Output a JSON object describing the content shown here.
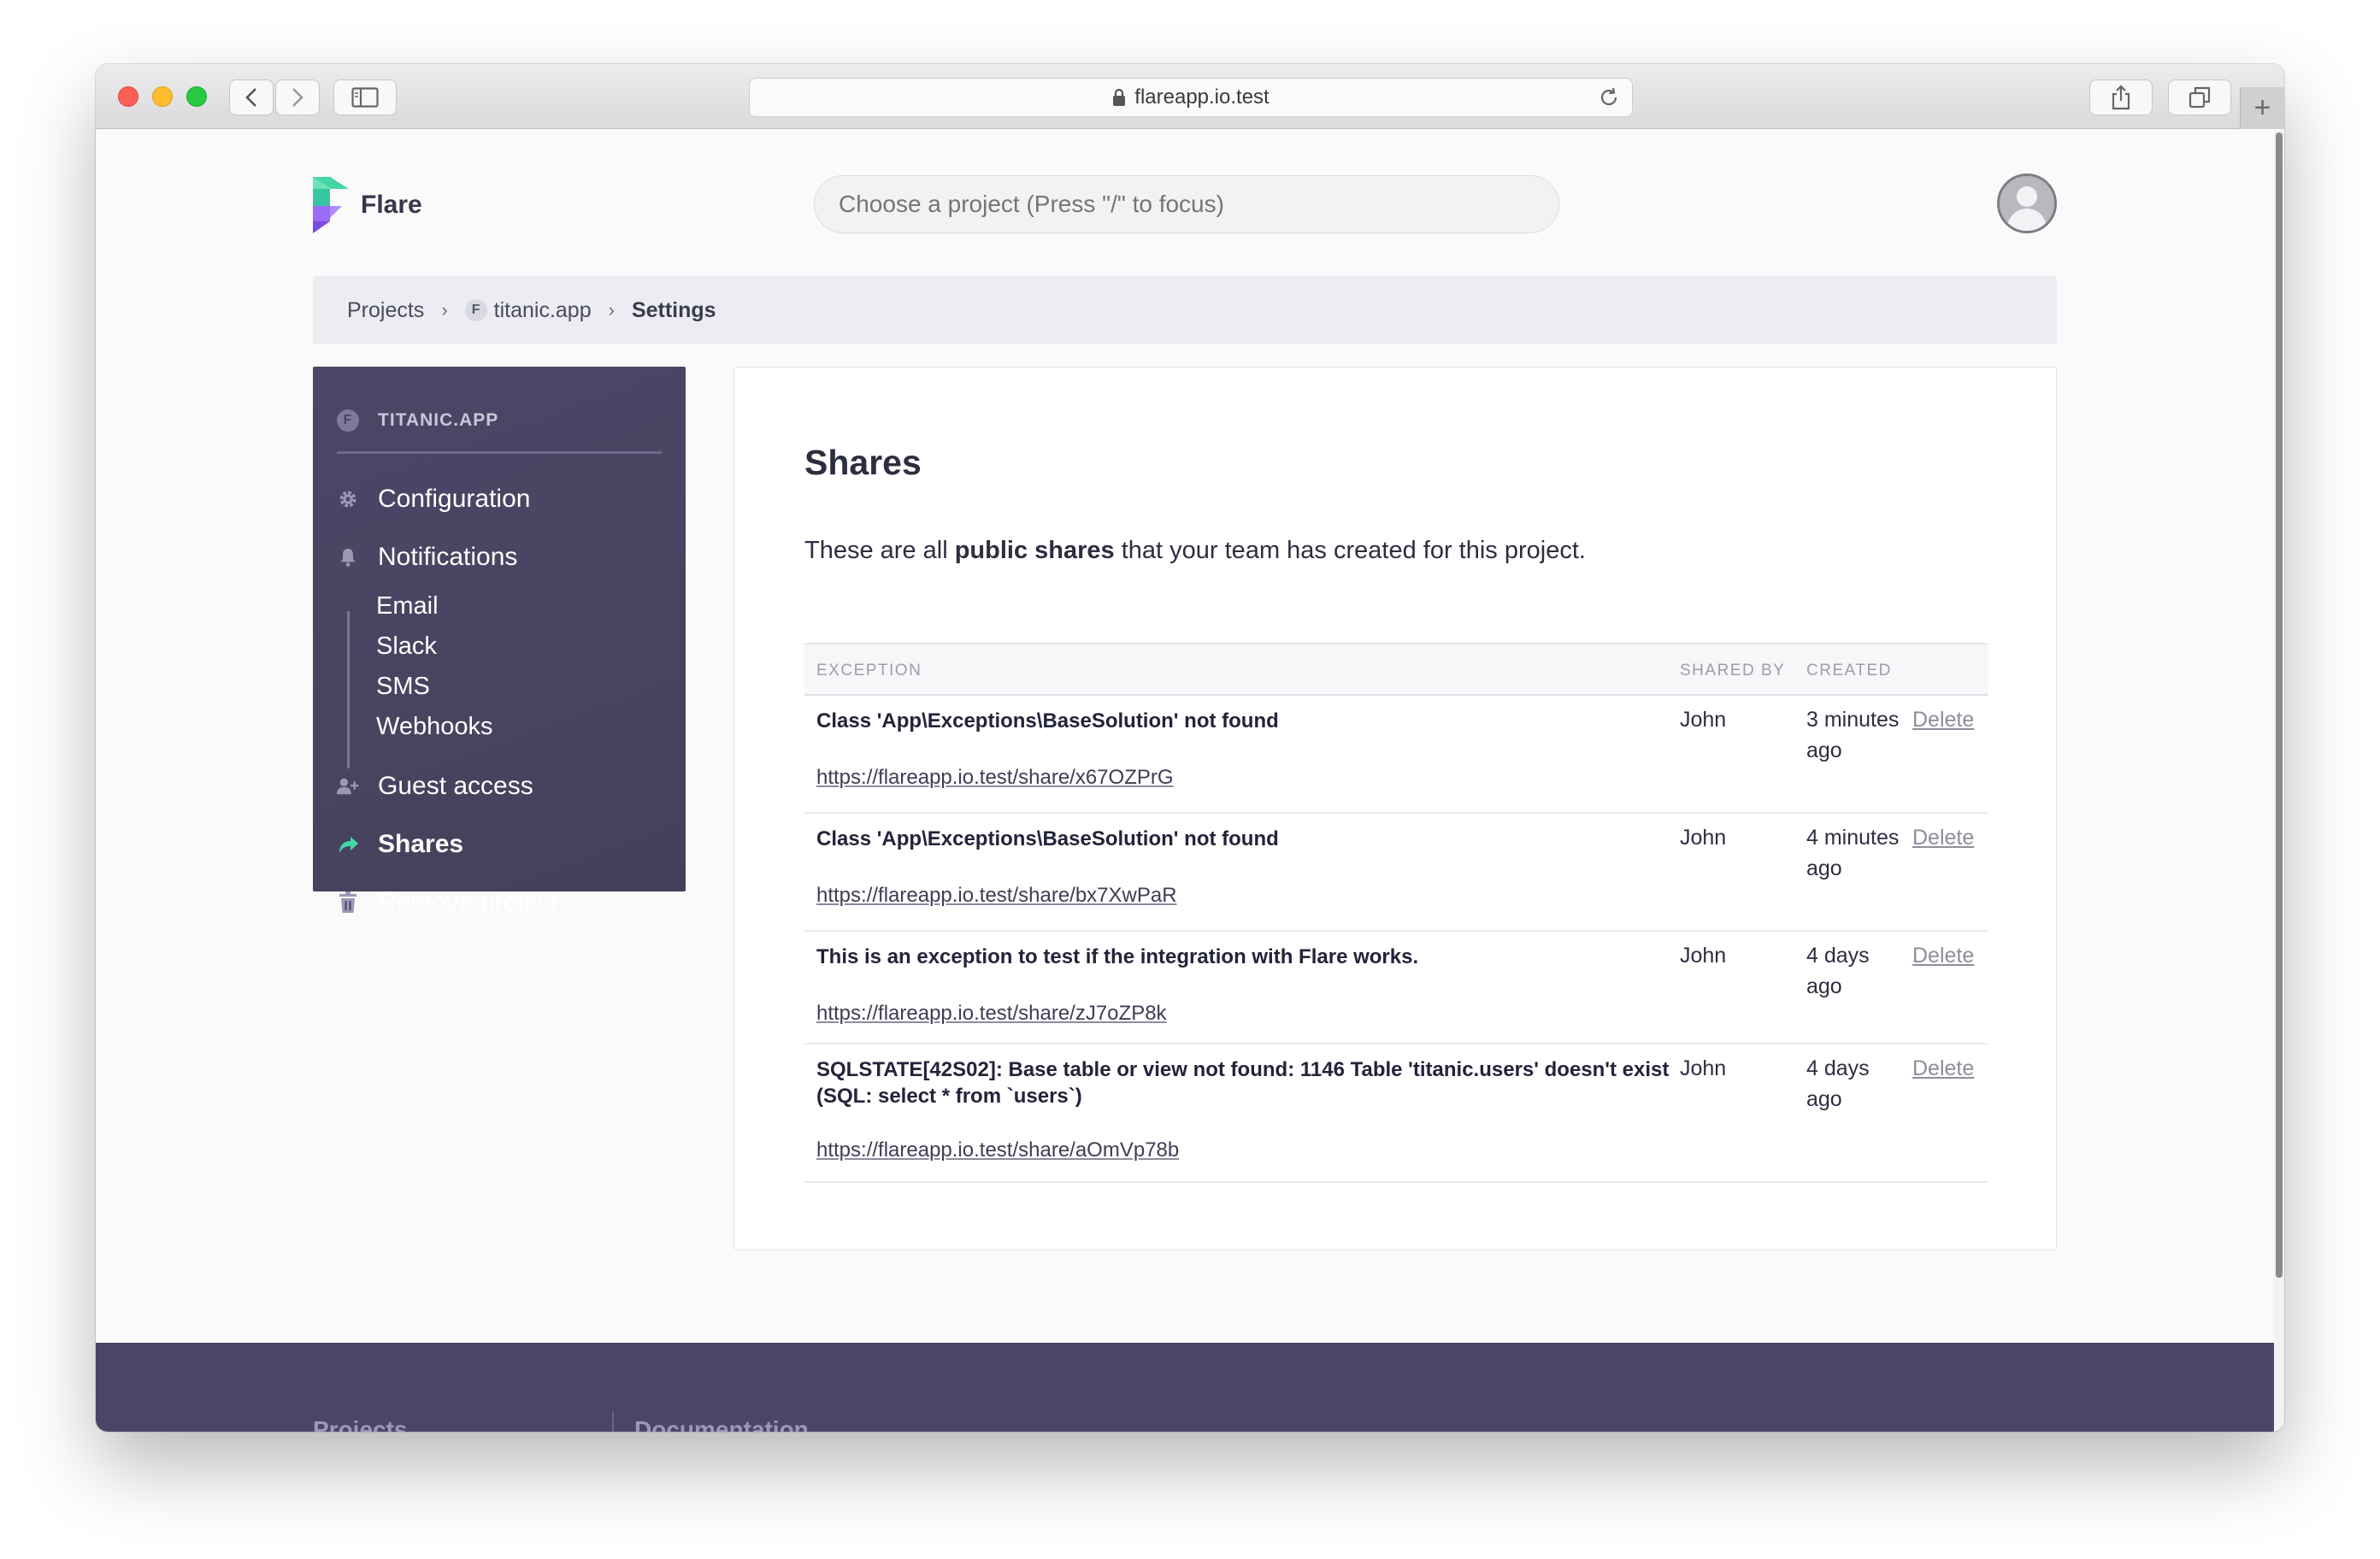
{
  "browser": {
    "url": "flareapp.io.test"
  },
  "app": {
    "name": "Flare",
    "search_placeholder": "Choose a project (Press \"/\" to focus)"
  },
  "breadcrumb": {
    "projects": "Projects",
    "project_badge": "F",
    "project": "titanic.app",
    "current": "Settings"
  },
  "sidebar": {
    "project_badge": "F",
    "project_name": "TITANIC.APP",
    "items": [
      {
        "label": "Configuration",
        "icon": "gear-icon"
      },
      {
        "label": "Notifications",
        "icon": "bell-icon"
      },
      {
        "label": "Guest access",
        "icon": "user-plus-icon"
      },
      {
        "label": "Shares",
        "icon": "share-arrow-icon",
        "active": true
      },
      {
        "label": "Remove project",
        "icon": "trash-icon"
      }
    ],
    "notification_subitems": [
      "Email",
      "Slack",
      "SMS",
      "Webhooks"
    ]
  },
  "main": {
    "title": "Shares",
    "intro_before": "These are all ",
    "intro_bold": "public shares",
    "intro_after": " that your team has created for this project.",
    "columns": [
      "EXCEPTION",
      "SHARED BY",
      "CREATED"
    ],
    "rows": [
      {
        "exception": "Class 'App\\Exceptions\\BaseSolution' not found",
        "link": "https://flareapp.io.test/share/x67OZPrG",
        "shared_by": "John",
        "created": "3 minutes ago",
        "action": "Delete"
      },
      {
        "exception": "Class 'App\\Exceptions\\BaseSolution' not found",
        "link": "https://flareapp.io.test/share/bx7XwPaR",
        "shared_by": "John",
        "created": "4 minutes ago",
        "action": "Delete"
      },
      {
        "exception": "This is an exception to test if the integration with Flare works.",
        "link": "https://flareapp.io.test/share/zJ7oZP8k",
        "shared_by": "John",
        "created": "4 days ago",
        "action": "Delete"
      },
      {
        "exception": "SQLSTATE[42S02]: Base table or view not found: 1146 Table 'titanic.users' doesn't exist (SQL: select * from `users`)",
        "link": "https://flareapp.io.test/share/aOmVp78b",
        "shared_by": "John",
        "created": "4 days ago",
        "action": "Delete"
      }
    ]
  },
  "footer": {
    "links": [
      "Projects",
      "Documentation"
    ]
  },
  "colors": {
    "sidebar_bg": "#4b4667",
    "accent_green": "#44d6a4",
    "accent_purple": "#8a5cf6"
  }
}
